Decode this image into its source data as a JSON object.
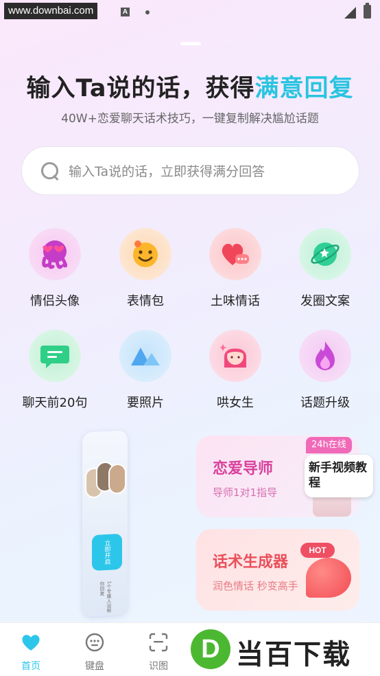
{
  "status_bar": {
    "watermark_url": "www.downbai.com"
  },
  "header": {
    "title_main": "输入Ta说的话，获得",
    "title_accent": "满意回复",
    "subtitle": "40W+恋爱聊天话术技巧，一键复制解决尴尬话题",
    "accent_color": "#29c4e0"
  },
  "search": {
    "placeholder": "输入Ta说的话，立即获得满分回答"
  },
  "grid": [
    {
      "label": "情侣头像",
      "icon": "octopus-icon",
      "color": "#f7d6f3"
    },
    {
      "label": "表情包",
      "icon": "smiley-icon",
      "color": "#fde5cf"
    },
    {
      "label": "土味情话",
      "icon": "chat-heart-icon",
      "color": "#fcd9dc"
    },
    {
      "label": "发圈文案",
      "icon": "globe-icon",
      "color": "#d5f5e6"
    },
    {
      "label": "聊天前20句",
      "icon": "message-icon",
      "color": "#d6f3e2"
    },
    {
      "label": "要照片",
      "icon": "mountain-icon",
      "color": "#d8ecfb"
    },
    {
      "label": "哄女生",
      "icon": "girl-icon",
      "color": "#fcdde7"
    },
    {
      "label": "话题升级",
      "icon": "flame-icon",
      "color": "#f6dcf6"
    }
  ],
  "promo_phone": {
    "button": "立即开启",
    "note": "1个专属人设帮你回复"
  },
  "cards": [
    {
      "title": "恋爱导师",
      "subtitle": "导师1对1指导",
      "badge": "24h在线",
      "tutorial": "新手视频教程"
    },
    {
      "title": "话术生成器",
      "subtitle": "润色情话 秒变高手",
      "badge": "HOT"
    }
  ],
  "tabs": [
    {
      "label": "首页",
      "icon": "heart-icon",
      "active": true
    },
    {
      "label": "键盘",
      "icon": "keyboard-icon",
      "active": false
    },
    {
      "label": "识图",
      "icon": "scan-icon",
      "active": false
    }
  ],
  "watermark_logo": {
    "letter": "D",
    "text": "当百下载"
  }
}
